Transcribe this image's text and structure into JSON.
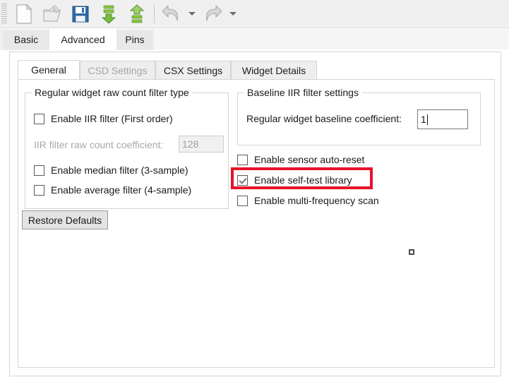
{
  "toolbar": {
    "buttons": [
      {
        "name": "new-file-icon",
        "title": "New"
      },
      {
        "name": "open-folder-icon",
        "title": "Open"
      },
      {
        "name": "save-floppy-icon",
        "title": "Save"
      },
      {
        "name": "download-arrow-icon",
        "title": "Download"
      },
      {
        "name": "upload-arrow-icon",
        "title": "Upload"
      },
      {
        "name": "undo-arrow-icon",
        "title": "Undo"
      },
      {
        "name": "redo-arrow-icon",
        "title": "Redo"
      }
    ]
  },
  "outer_tabs": [
    {
      "label": "Basic",
      "active": false
    },
    {
      "label": "Advanced",
      "active": true
    },
    {
      "label": "Pins",
      "active": false
    }
  ],
  "inner_tabs": [
    {
      "label": "General",
      "active": true,
      "disabled": false
    },
    {
      "label": "CSD Settings",
      "active": false,
      "disabled": true
    },
    {
      "label": "CSX Settings",
      "active": false,
      "disabled": false
    },
    {
      "label": "Widget Details",
      "active": false,
      "disabled": false
    }
  ],
  "left_group": {
    "title": "Regular widget raw count filter type",
    "iir_checkbox_label": "Enable IIR filter (First order)",
    "iir_coefficient_label": "IIR filter raw count coefficient:",
    "iir_coefficient_value": "128",
    "median_checkbox_label": "Enable median filter (3-sample)",
    "average_checkbox_label": "Enable average filter (4-sample)"
  },
  "right_group": {
    "title": "Baseline IIR filter settings",
    "baseline_coefficient_label": "Regular widget baseline coefficient:",
    "baseline_coefficient_value": "1"
  },
  "right_checkboxes": [
    {
      "label": "Enable sensor auto-reset",
      "checked": false
    },
    {
      "label": "Enable self-test library",
      "checked": true
    },
    {
      "label": "Enable multi-frequency scan",
      "checked": false
    }
  ],
  "restore_button_label": "Restore Defaults",
  "colors": {
    "highlight": "#e8122a",
    "toolbar_bg": "#f0f0f0",
    "panel_bg": "#ffffff",
    "group_border": "#d4d4d4",
    "disabled_text": "#a8a8a8",
    "save_icon_blue": "#2d6ca8",
    "arrow_green": "#6cb33f"
  }
}
